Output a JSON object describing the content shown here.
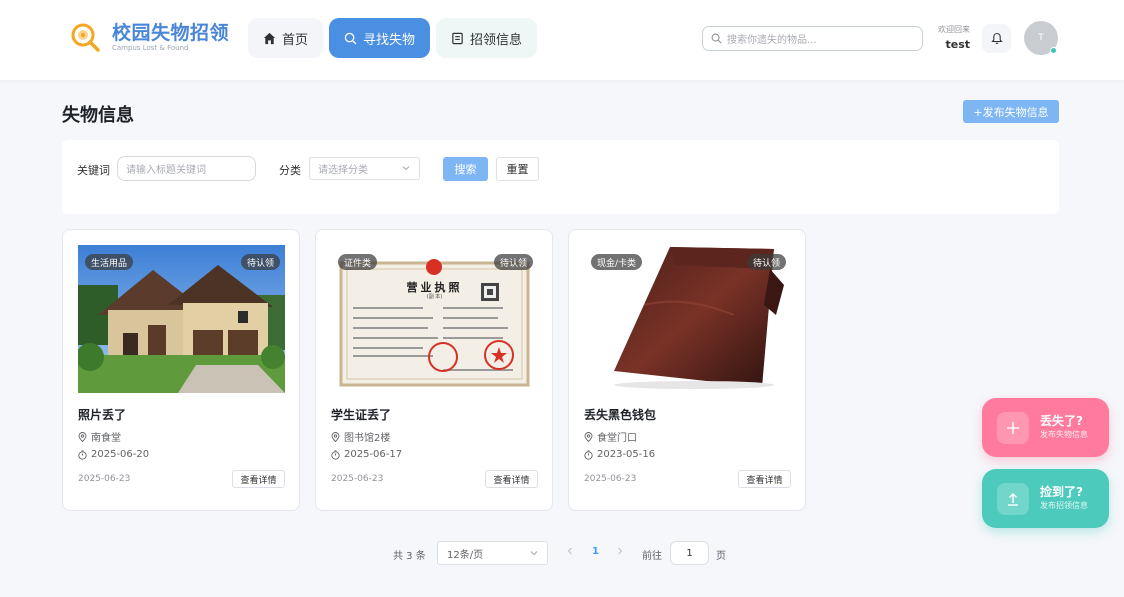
{
  "header": {
    "logo_title": "校园失物招领",
    "logo_subtitle": "Campus Lost & Found",
    "nav": [
      {
        "label": "首页"
      },
      {
        "label": "寻找失物"
      },
      {
        "label": "招领信息"
      }
    ],
    "search_placeholder": "搜索你遗失的物品...",
    "welcome_label": "欢迎回来",
    "username": "test",
    "avatar_letter": "T"
  },
  "page": {
    "title": "失物信息",
    "publish_button": "+发布失物信息"
  },
  "filter": {
    "keyword_label": "关键词",
    "keyword_placeholder": "请输入标题关键词",
    "category_label": "分类",
    "category_placeholder": "请选择分类",
    "search_button": "搜索",
    "reset_button": "重置"
  },
  "cards": [
    {
      "category": "生活用品",
      "status": "待认领",
      "title": "照片丢了",
      "location": "南食堂",
      "lost_date": "2025-06-20",
      "publish_date": "2025-06-23",
      "button": "查看详情"
    },
    {
      "category": "证件类",
      "status": "待认领",
      "title": "学生证丢了",
      "location": "图书馆2楼",
      "lost_date": "2025-06-17",
      "publish_date": "2025-06-23",
      "button": "查看详情"
    },
    {
      "category": "现金/卡类",
      "status": "待认领",
      "title": "丢失黑色钱包",
      "location": "食堂门口",
      "lost_date": "2023-05-16",
      "publish_date": "2025-06-23",
      "button": "查看详情"
    }
  ],
  "license_image": {
    "heading": "营业执照",
    "subheading": "(副 本)"
  },
  "pagination": {
    "total": "共 3 条",
    "page_size": "12条/页",
    "current_page": "1",
    "goto_label": "前往",
    "goto_value": "1",
    "page_suffix": "页"
  },
  "floating": {
    "lost_title": "丢失了?",
    "lost_sub": "发布失物信息",
    "found_title": "捡到了?",
    "found_sub": "发布招领信息"
  },
  "colors": {
    "primary": "#4a8fe2",
    "light_primary": "#7eb6f4",
    "lost": "#ff7a9c",
    "found": "#4ccbbd"
  }
}
